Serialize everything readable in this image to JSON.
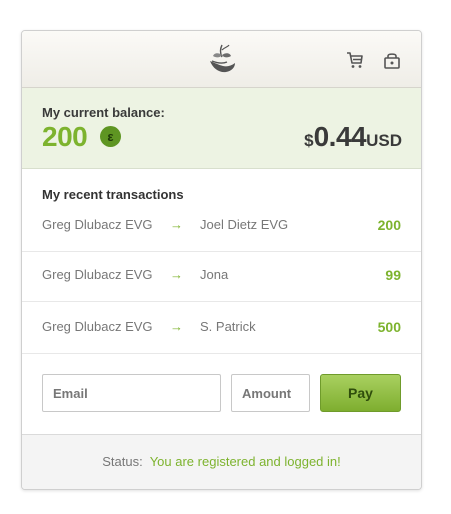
{
  "header": {
    "logo_icon": "plant-in-hand-icon",
    "cart_icon": "cart-icon",
    "lock_icon": "lock-icon"
  },
  "balance": {
    "label": "My current balance:",
    "amount": "200",
    "coin_symbol": "ε",
    "usd_symbol": "$",
    "usd_value": "0.44",
    "usd_unit": "USD"
  },
  "transactions": {
    "title": "My recent transactions",
    "arrow": "→",
    "rows": [
      {
        "from": "Greg Dlubacz EVG",
        "to": "Joel Dietz EVG",
        "amount": "200"
      },
      {
        "from": "Greg Dlubacz EVG",
        "to": "Jona",
        "amount": "99"
      },
      {
        "from": "Greg Dlubacz EVG",
        "to": "S. Patrick",
        "amount": "500"
      }
    ]
  },
  "form": {
    "email_placeholder": "Email",
    "amount_placeholder": "Amount",
    "pay_label": "Pay"
  },
  "status": {
    "label": "Status:",
    "message": "You are registered and logged in!"
  },
  "colors": {
    "accent": "#7db32e",
    "balance_bg": "#edf3e3"
  }
}
